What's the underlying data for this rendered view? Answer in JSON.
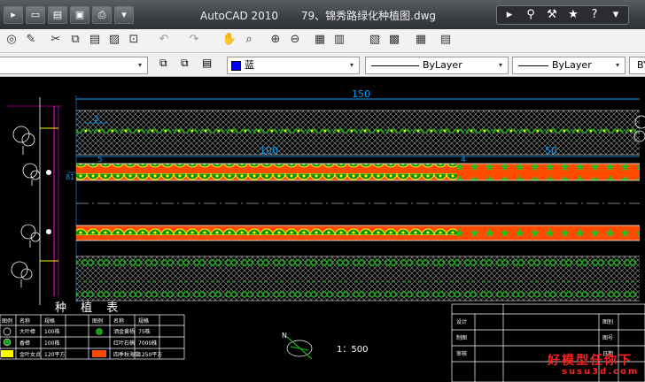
{
  "title_bar": {
    "app": "AutoCAD 2010",
    "file": "79、锦秀路绿化种植图.dwg"
  },
  "quick_access": [
    "new-icon",
    "open-icon",
    "save-icon",
    "print-icon",
    "dropdown-icon"
  ],
  "info_tools": [
    "binoculars-icon",
    "arrow-icon",
    "wrench-icon",
    "star-icon",
    "help-icon"
  ],
  "properties": {
    "color": "蓝",
    "linetype": "ByLayer",
    "lineweight": "ByLayer",
    "plotstyle": "BY"
  },
  "drawing": {
    "dims": {
      "top_total": "150",
      "left_small": "2",
      "mid_left": "100",
      "mid_right": "50",
      "small4": "4",
      "small5": "5",
      "left_81": "81"
    },
    "planting_table": {
      "title": "种 植 表",
      "headers": [
        "图例",
        "名称",
        "规格",
        "图例",
        "名称",
        "规格"
      ],
      "rows": [
        [
          "",
          "大叶樟",
          "100株",
          "",
          "洒金黄杨",
          "75株"
        ],
        [
          "",
          "香樟",
          "100株",
          "",
          "红叶石楠",
          "7000株"
        ],
        [
          "",
          "金叶女贞",
          "120平方",
          "",
          "四季秋海棠",
          "1250平方"
        ]
      ]
    },
    "scale": "1：500",
    "north": "N",
    "title_block_labels": [
      "设计",
      "制图",
      "审核",
      "图别",
      "图号",
      "日期"
    ]
  },
  "colors": {
    "accent_blue": "#0000ff",
    "cad_green": "#1a8a1a",
    "cad_orange": "#ff4a00",
    "cad_yellow": "#ffff00",
    "magenta": "#ff00ff",
    "cyan": "#00c0ff"
  },
  "watermark": {
    "line1": "好模型任你下",
    "line2": "susu3d.com"
  }
}
